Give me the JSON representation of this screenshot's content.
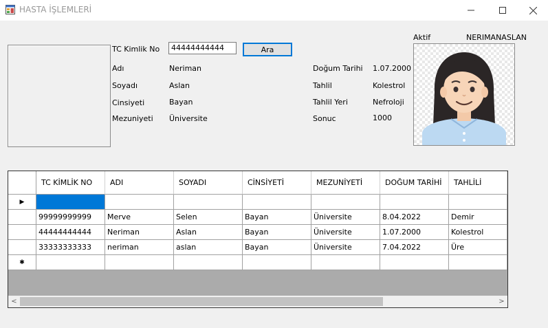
{
  "window": {
    "title": "HASTA İŞLEMLERİ",
    "minimize": "—",
    "maximize": "☐",
    "close": "✕"
  },
  "search": {
    "tc_label": "TC Kimlik No",
    "tc_value": "44444444444",
    "button": "Ara"
  },
  "fields": {
    "adi_label": "Adı",
    "adi_value": "Neriman",
    "soyadi_label": "Soyadı",
    "soyadi_value": "Aslan",
    "cinsiyet_label": "Cinsiyeti",
    "cinsiyet_value": "Bayan",
    "mezuniyet_label": "Mezuniyeti",
    "mezuniyet_value": "Üniversite",
    "dogum_label": "Doğum Tarihi",
    "dogum_value": "1.07.2000",
    "tahlil_label": "Tahlil",
    "tahlil_value": "Kolestrol",
    "tahlil_yeri_label": "Tahlil Yeri",
    "tahlil_yeri_value": "Nefroloji",
    "sonuc_label": "Sonuc",
    "sonuc_value": "1000"
  },
  "user": {
    "status": "Aktif",
    "username": "NERIMANASLAN",
    "avatar_icon": "woman-avatar-icon"
  },
  "grid": {
    "headers": [
      "TC KİMLİK NO",
      "ADI",
      "SOYADI",
      "CİNSİYETİ",
      "MEZUNİYETİ",
      "DOĞUM TARİHİ",
      "TAHLİLİ"
    ],
    "rows": [
      [
        "",
        "",
        "",
        "",
        "",
        "",
        ""
      ],
      [
        "99999999999",
        "Merve",
        "Selen",
        "Bayan",
        "Üniversite",
        "8.04.2022",
        "Demir"
      ],
      [
        "44444444444",
        "Neriman",
        "Aslan",
        "Bayan",
        "Üniversite",
        "1.07.2000",
        "Kolestrol"
      ],
      [
        "33333333333",
        "neriman",
        "aslan",
        "Bayan",
        "Üniversite",
        "7.04.2022",
        "Üre"
      ],
      [
        "",
        "",
        "",
        "",
        "",
        "",
        ""
      ]
    ],
    "row_markers": [
      "▶",
      "",
      "",
      "",
      "✱"
    ]
  }
}
